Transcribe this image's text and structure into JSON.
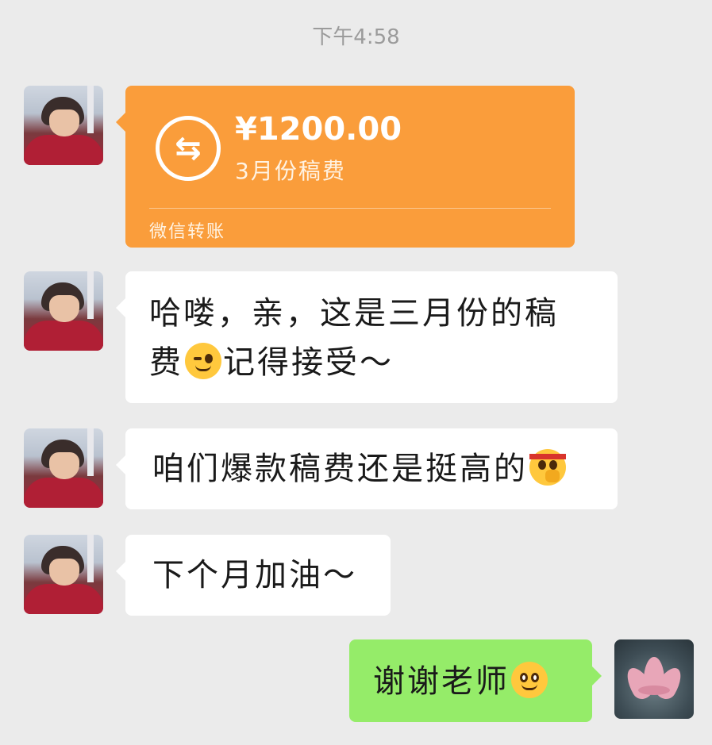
{
  "timestamp": "下午4:58",
  "transfer": {
    "currency_icon": "transfer-arrows-icon",
    "amount": "¥1200.00",
    "note": "3月份稿费",
    "footer": "微信转账",
    "color": "#fa9d3b"
  },
  "messages": [
    {
      "line1": "哈喽，亲，这是三月份的稿",
      "line2a": "费",
      "emoji": "winking-emoji",
      "line2b": "记得接受～"
    },
    {
      "text": "咱们爆款稿费还是挺高的",
      "emoji": "headband-thinking-emoji"
    },
    {
      "text": "下个月加油～"
    }
  ],
  "reply": {
    "text": "谢谢老师",
    "emoji": "smiling-emoji",
    "color": "#95ec69"
  }
}
